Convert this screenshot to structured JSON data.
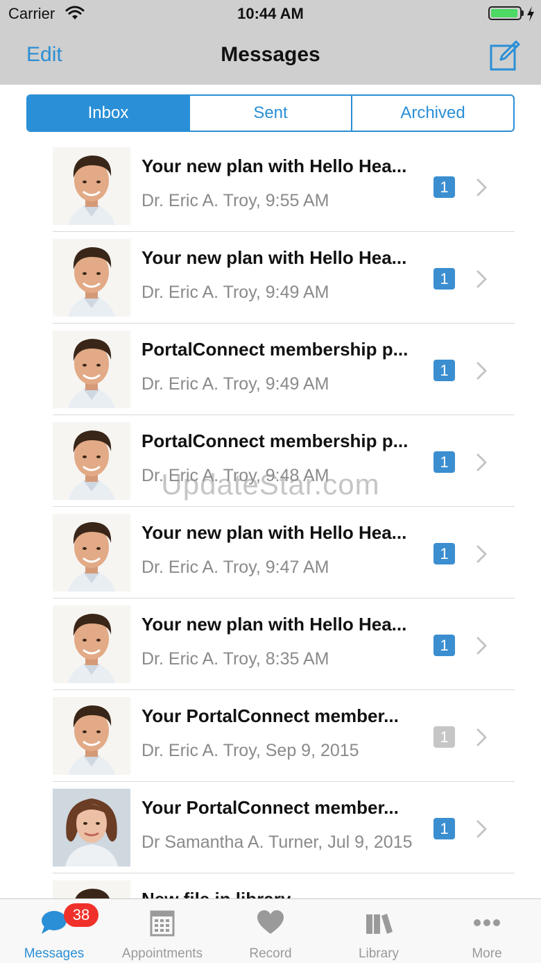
{
  "status_bar": {
    "carrier": "Carrier",
    "time": "10:44 AM"
  },
  "nav": {
    "edit_label": "Edit",
    "title": "Messages",
    "compose_icon": "compose-icon"
  },
  "segments": [
    {
      "label": "Inbox",
      "active": true
    },
    {
      "label": "Sent",
      "active": false
    },
    {
      "label": "Archived",
      "active": false
    }
  ],
  "messages": [
    {
      "subject": "Your new plan with Hello Hea...",
      "meta": "Dr. Eric A. Troy, 9:55 AM",
      "badge": "1",
      "badge_state": "unread",
      "avatar": "doctor-male-avatar"
    },
    {
      "subject": "Your new plan with Hello Hea...",
      "meta": "Dr. Eric A. Troy, 9:49 AM",
      "badge": "1",
      "badge_state": "unread",
      "avatar": "doctor-male-avatar"
    },
    {
      "subject": "PortalConnect membership p...",
      "meta": "Dr. Eric A. Troy, 9:49 AM",
      "badge": "1",
      "badge_state": "unread",
      "avatar": "doctor-male-avatar"
    },
    {
      "subject": "PortalConnect membership p...",
      "meta": "Dr. Eric A. Troy, 9:48 AM",
      "badge": "1",
      "badge_state": "unread",
      "avatar": "doctor-male-avatar"
    },
    {
      "subject": "Your new plan with Hello Hea...",
      "meta": "Dr. Eric A. Troy, 9:47 AM",
      "badge": "1",
      "badge_state": "unread",
      "avatar": "doctor-male-avatar"
    },
    {
      "subject": "Your new plan with Hello Hea...",
      "meta": "Dr. Eric A. Troy, 8:35 AM",
      "badge": "1",
      "badge_state": "unread",
      "avatar": "doctor-male-avatar"
    },
    {
      "subject": "Your PortalConnect member...",
      "meta": "Dr. Eric A. Troy, Sep 9, 2015",
      "badge": "1",
      "badge_state": "read",
      "avatar": "doctor-male-avatar"
    },
    {
      "subject": "Your PortalConnect member...",
      "meta": "Dr Samantha A. Turner, Jul 9, 2015",
      "badge": "1",
      "badge_state": "unread",
      "avatar": "doctor-female-avatar"
    },
    {
      "subject": "New file in library",
      "meta": "",
      "badge": "",
      "badge_state": "",
      "avatar": "doctor-male-avatar"
    }
  ],
  "watermark": "UpdateStar.com",
  "tabbar": {
    "items": [
      {
        "label": "Messages",
        "icon": "chat-bubble-icon",
        "active": true,
        "badge": "38"
      },
      {
        "label": "Appointments",
        "icon": "calendar-icon",
        "active": false
      },
      {
        "label": "Record",
        "icon": "heart-icon",
        "active": false
      },
      {
        "label": "Library",
        "icon": "books-icon",
        "active": false
      },
      {
        "label": "More",
        "icon": "more-dots-icon",
        "active": false
      }
    ]
  },
  "colors": {
    "accent": "#2a8fd6",
    "badge_unread": "#3b8ed0",
    "badge_read": "#c6c6c6",
    "tab_badge": "#f0312b"
  }
}
